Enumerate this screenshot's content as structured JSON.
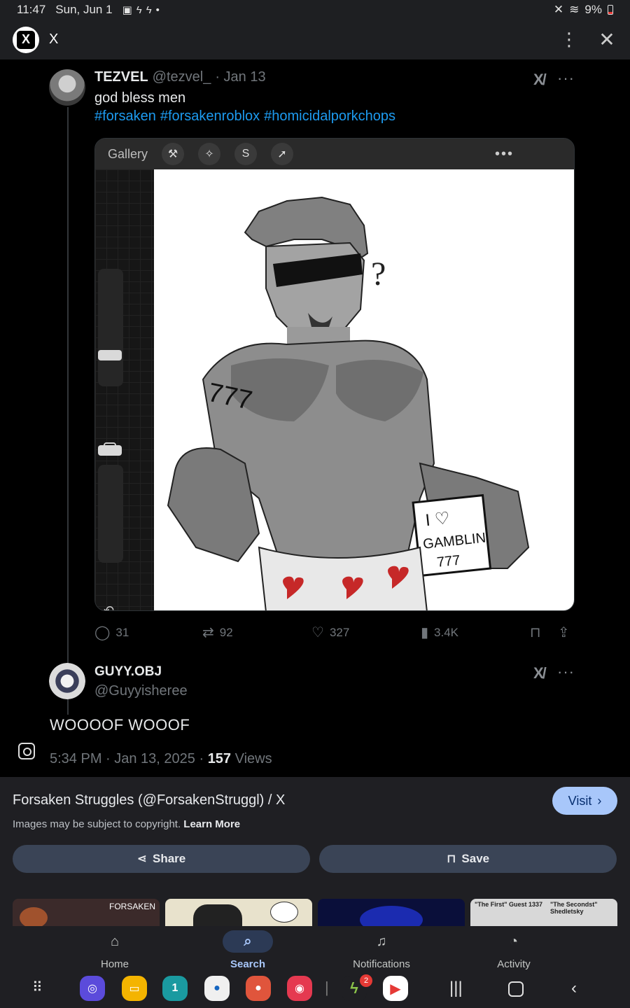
{
  "status_bar": {
    "time": "11:47",
    "date": "Sun, Jun 1",
    "battery": "9%"
  },
  "app_bar": {
    "logo": "X",
    "title": "X"
  },
  "tweet": {
    "name": "TEZVEL",
    "handle": "@tezvel_",
    "date": "· Jan 13",
    "text": "god bless men",
    "hashtags": [
      "#forsaken",
      "#forsakenroblox",
      "#homicidalporkchops"
    ],
    "media": {
      "app_label": "Gallery",
      "sign_line1": "I ♡",
      "sign_line2": "GAMBLIN",
      "sign_line3": "777",
      "arm_mark": "777"
    },
    "stats": {
      "replies": "31",
      "reposts": "92",
      "likes": "327",
      "views": "3.4K"
    }
  },
  "reply": {
    "name": "GUYY.OBJ",
    "handle": "@Guyyisheree",
    "text": "WOOOOF WOOOF",
    "timestamp": "5:34 PM · Jan 13, 2025 · ",
    "views_count": "157",
    "views_label": " Views"
  },
  "sheet": {
    "title": "Forsaken Struggles (@ForsakenStruggl) / X",
    "visit": "Visit",
    "note": "Images may be subject to copyright. ",
    "learn_more": "Learn More",
    "share": "Share",
    "save": "Save",
    "thumb1_text": "FORSAKEN",
    "thumb4_left": "\"The First\" Guest 1337",
    "thumb4_right": "\"The Secondst\" Shedletsky"
  },
  "bottom_nav": {
    "home": "Home",
    "search": "Search",
    "notifications": "Notifications",
    "activity": "Activity"
  },
  "dock": {
    "badge": "2"
  },
  "colors": {
    "link": "#1d9bf0",
    "accent": "#a8c7fa",
    "button_bg": "#3a4456",
    "surface": "#1f1f23"
  }
}
